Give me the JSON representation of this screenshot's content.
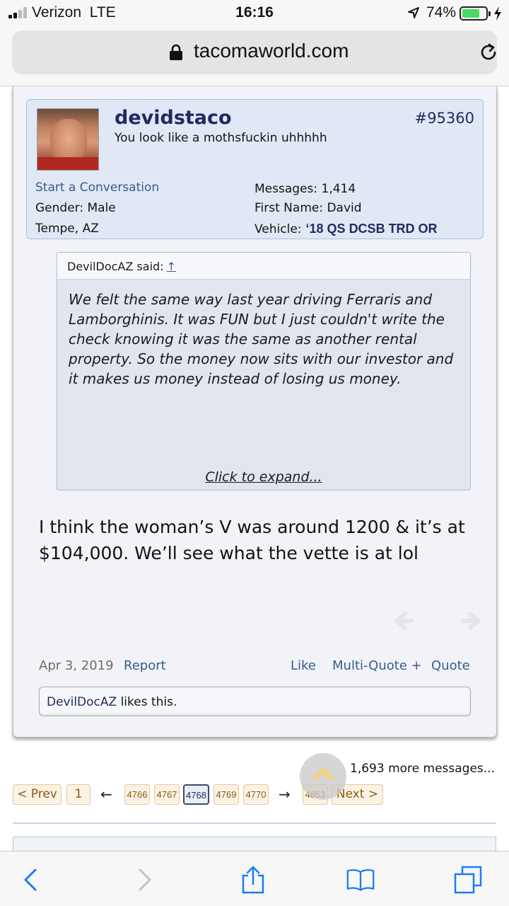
{
  "status_bar": {
    "carrier": "Verizon",
    "network": "LTE",
    "time": "16:16",
    "battery_percent": "74%",
    "battery_level": 0.74
  },
  "browser": {
    "url": "tacomaworld.com"
  },
  "post": {
    "username": "devidstaco",
    "user_title": "You look like a mothsfuckin uhhhhh",
    "post_number": "#95360",
    "start_conversation": "Start a Conversation",
    "gender_label": "Gender:",
    "gender_value": "Male",
    "location": "Tempe, AZ",
    "messages_label": "Messages:",
    "messages_value": "1,414",
    "firstname_label": "First Name:",
    "firstname_value": "David",
    "vehicle_label": "Vehicle:",
    "vehicle_value": "‘18 QS DCSB TRD OR",
    "quote": {
      "author": "DevilDocAZ said:",
      "arrow": "↑",
      "text": "We felt the same way last year driving Ferraris and Lamborghinis. It was FUN but I just couldn't write the check knowing it was the same as another rental property. So the money now sits with our investor and it makes us money instead of losing us money.",
      "expand_label": "Click to expand..."
    },
    "message": "I think the woman’s V was around 1200 & it’s at $104,000. We’ll see what the vette is at lol",
    "date": "Apr 3, 2019",
    "report_label": "Report",
    "like_label": "Like",
    "multiquote_label": "Multi-Quote +",
    "quote_label": "Quote",
    "likes_user": "DevilDocAZ",
    "likes_suffix": " likes this."
  },
  "pagination": {
    "more_messages": "1,693 more messages...",
    "prev_label": "< Prev",
    "first_page": "1",
    "left_arrow": "←",
    "pages": [
      "4766",
      "4767",
      "4768",
      "4769",
      "4770"
    ],
    "current_page": "4768",
    "right_arrow": "→",
    "last_page": "4853",
    "next_label": "Next >"
  },
  "toolbar": {
    "icons": [
      "back-icon",
      "forward-icon",
      "share-icon",
      "bookmarks-icon",
      "tabs-icon"
    ]
  },
  "colors": {
    "accent": "#1e2b5e",
    "link": "#3a5a8c",
    "ios_blue": "#1a7cf5",
    "battery_green": "#4cd964"
  }
}
